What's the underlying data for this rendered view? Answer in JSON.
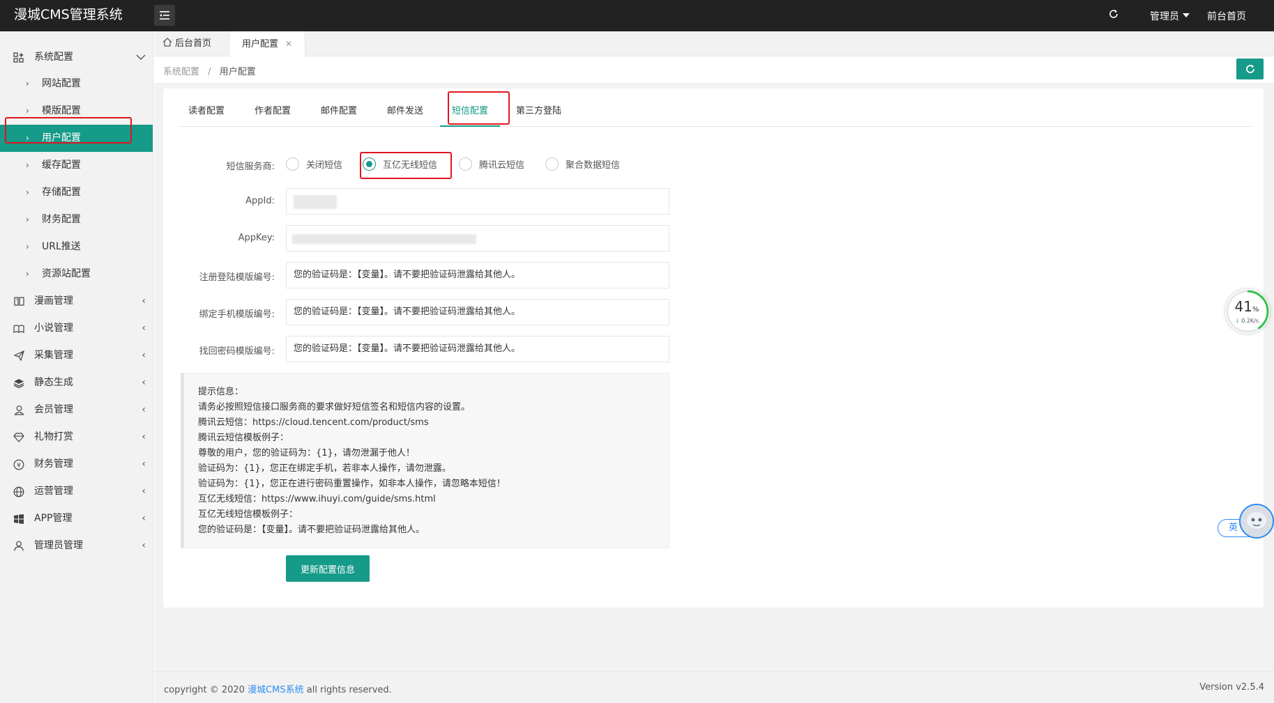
{
  "app": {
    "title": "漫城CMS管理系统"
  },
  "header": {
    "admin_label": "管理员",
    "front_label": "前台首页"
  },
  "sidebar": {
    "group": {
      "label": "系统配置"
    },
    "subitems": [
      {
        "label": "网站配置"
      },
      {
        "label": "模版配置"
      },
      {
        "label": "用户配置"
      },
      {
        "label": "缓存配置"
      },
      {
        "label": "存储配置"
      },
      {
        "label": "财务配置"
      },
      {
        "label": "URL推送"
      },
      {
        "label": "资源站配置"
      }
    ],
    "modules": [
      {
        "label": "漫画管理",
        "icon": "book-icon"
      },
      {
        "label": "小说管理",
        "icon": "open-book-icon"
      },
      {
        "label": "采集管理",
        "icon": "send-icon"
      },
      {
        "label": "静态生成",
        "icon": "layers-icon"
      },
      {
        "label": "会员管理",
        "icon": "user-icon"
      },
      {
        "label": "礼物打赏",
        "icon": "diamond-icon"
      },
      {
        "label": "财务管理",
        "icon": "yen-icon"
      },
      {
        "label": "运营管理",
        "icon": "globe-icon"
      },
      {
        "label": "APP管理",
        "icon": "windows-icon"
      },
      {
        "label": "管理员管理",
        "icon": "person-icon"
      }
    ]
  },
  "page_tabs": {
    "home": "后台首页",
    "current": "用户配置"
  },
  "breadcrumb": {
    "parent": "系统配置",
    "current": "用户配置"
  },
  "config_tabs": [
    "读者配置",
    "作者配置",
    "邮件配置",
    "邮件发送",
    "短信配置",
    "第三方登陆"
  ],
  "form": {
    "provider_label": "短信服务商:",
    "providers": [
      "关闭短信",
      "互亿无线短信",
      "腾讯云短信",
      "聚合数据短信"
    ],
    "selected_provider": "互亿无线短信",
    "appid_label": "AppId:",
    "appkey_label": "AppKey:",
    "register_label": "注册登陆模版编号:",
    "register_value": "您的验证码是：【变量】。请不要把验证码泄露给其他人。",
    "bind_label": "绑定手机模版编号:",
    "bind_value": "您的验证码是：【变量】。请不要把验证码泄露给其他人。",
    "recover_label": "找回密码模版编号:",
    "recover_value": "您的验证码是：【变量】。请不要把验证码泄露给其他人。",
    "submit_label": "更新配置信息"
  },
  "tips": [
    "提示信息：",
    "请务必按照短信接口服务商的要求做好短信签名和短信内容的设置。",
    "腾讯云短信：https://cloud.tencent.com/product/sms",
    "腾讯云短信模板例子：",
    "尊敬的用户，您的验证码为：{1}，请勿泄漏于他人！",
    "验证码为：{1}，您正在绑定手机，若非本人操作，请勿泄露。",
    "验证码为：{1}，您正在进行密码重置操作，如非本人操作，请忽略本短信！",
    "互亿无线短信：https://www.ihuyi.com/guide/sms.html",
    "互亿无线短信模板例子：",
    "您的验证码是：【变量】。请不要把验证码泄露给其他人。"
  ],
  "footer": {
    "prefix": "copyright © 2020",
    "link": "漫城CMS系统",
    "suffix": "all rights reserved.",
    "version": "Version v2.5.4"
  },
  "widgets": {
    "speed_percent": "41",
    "speed_unit": "%",
    "speed_rate": "0.2K/s",
    "ime_label": "英"
  },
  "colors": {
    "accent": "#169a89",
    "highlight": "#e0161e",
    "header_bg": "#222222"
  }
}
